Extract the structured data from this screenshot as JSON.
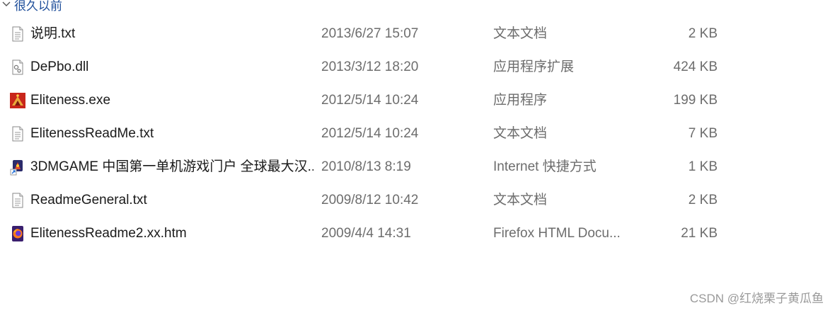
{
  "group": {
    "label": "很久以前"
  },
  "files": [
    {
      "name": "说明.txt",
      "date": "2013/6/27 15:07",
      "type": "文本文档",
      "size": "2 KB",
      "icon": "text-file-icon"
    },
    {
      "name": "DePbo.dll",
      "date": "2013/3/12 18:20",
      "type": "应用程序扩展",
      "size": "424 KB",
      "icon": "dll-file-icon"
    },
    {
      "name": "Eliteness.exe",
      "date": "2012/5/14 10:24",
      "type": "应用程序",
      "size": "199 KB",
      "icon": "exe-app-icon"
    },
    {
      "name": "ElitenessReadMe.txt",
      "date": "2012/5/14 10:24",
      "type": "文本文档",
      "size": "7 KB",
      "icon": "text-file-icon"
    },
    {
      "name": "3DMGAME 中国第一单机游戏门户 全球最大汉...",
      "date": "2010/8/13 8:19",
      "type": "Internet 快捷方式",
      "size": "1 KB",
      "icon": "internet-shortcut-icon"
    },
    {
      "name": "ReadmeGeneral.txt",
      "date": "2009/8/12 10:42",
      "type": "文本文档",
      "size": "2 KB",
      "icon": "text-file-icon"
    },
    {
      "name": "ElitenessReadme2.xx.htm",
      "date": "2009/4/4 14:31",
      "type": "Firefox HTML Docu...",
      "size": "21 KB",
      "icon": "firefox-html-icon"
    }
  ],
  "watermark": "CSDN @红烧栗子黄瓜鱼",
  "colors": {
    "group_header": "#1e4e9a",
    "secondary_text": "#6d6d6d",
    "primary_text": "#1a1a1a"
  }
}
